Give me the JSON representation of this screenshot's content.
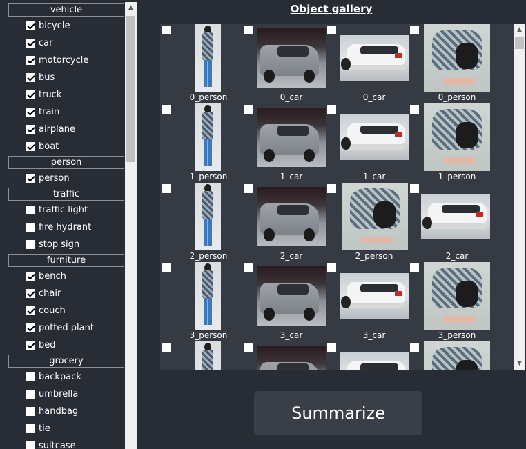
{
  "sidebar": {
    "categories": [
      {
        "header": "vehicle",
        "items": [
          {
            "label": "bicycle",
            "checked": true
          },
          {
            "label": "car",
            "checked": true
          },
          {
            "label": "motorcycle",
            "checked": true
          },
          {
            "label": "bus",
            "checked": true
          },
          {
            "label": "truck",
            "checked": true
          },
          {
            "label": "train",
            "checked": true
          },
          {
            "label": "airplane",
            "checked": true
          },
          {
            "label": "boat",
            "checked": true
          }
        ]
      },
      {
        "header": "person",
        "items": [
          {
            "label": "person",
            "checked": true
          }
        ]
      },
      {
        "header": "traffic",
        "items": [
          {
            "label": "traffic light",
            "checked": false
          },
          {
            "label": "fire hydrant",
            "checked": false
          },
          {
            "label": "stop sign",
            "checked": false
          }
        ]
      },
      {
        "header": "furniture",
        "items": [
          {
            "label": "bench",
            "checked": true
          },
          {
            "label": "chair",
            "checked": true
          },
          {
            "label": "couch",
            "checked": true
          },
          {
            "label": "potted plant",
            "checked": true
          },
          {
            "label": "bed",
            "checked": true
          }
        ]
      },
      {
        "header": "grocery",
        "items": [
          {
            "label": "backpack",
            "checked": false
          },
          {
            "label": "umbrella",
            "checked": false
          },
          {
            "label": "handbag",
            "checked": false
          },
          {
            "label": "tie",
            "checked": false
          },
          {
            "label": "suitcase",
            "checked": false
          }
        ]
      }
    ]
  },
  "gallery": {
    "title": "Object gallery",
    "rows": [
      [
        "0_person",
        "0_car",
        "0_car",
        "0_person"
      ],
      [
        "1_person",
        "1_car",
        "1_car",
        "1_person"
      ],
      [
        "2_person",
        "2_car",
        "2_person",
        "2_car"
      ],
      [
        "3_person",
        "3_car",
        "3_car",
        "3_person"
      ],
      [
        "",
        "",
        "",
        ""
      ]
    ],
    "row_kinds": [
      [
        "person-stand",
        "van",
        "suv",
        "person-crouch"
      ],
      [
        "person-stand",
        "van",
        "suv",
        "person-crouch"
      ],
      [
        "person-stand",
        "van",
        "person-crouch",
        "suv"
      ],
      [
        "person-stand",
        "van",
        "suv",
        "person-crouch"
      ],
      [
        "person-stand",
        "van",
        "suv",
        "person-crouch"
      ]
    ]
  },
  "actions": {
    "summarize_label": "Summarize"
  },
  "icons": {
    "scroll_up": "scroll-up-arrow-icon",
    "scroll_down": "scroll-down-arrow-icon",
    "checkbox": "checkbox-icon"
  }
}
